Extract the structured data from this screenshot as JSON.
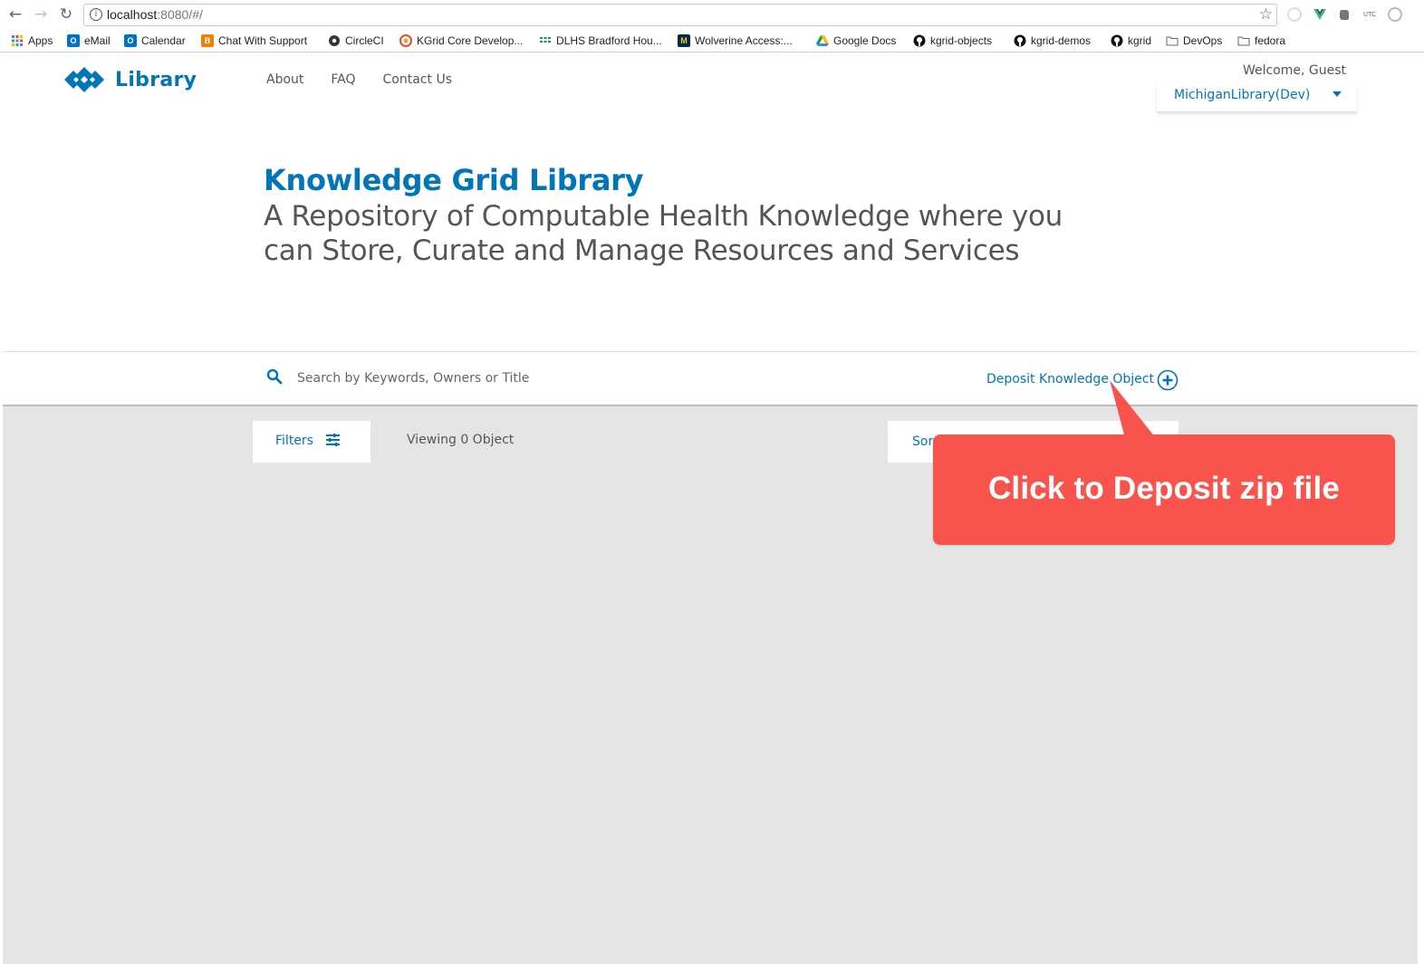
{
  "browser": {
    "url_host": "localhost",
    "url_rest": ":8080/#/",
    "bookmarks": [
      {
        "label": "Apps",
        "icon": "apps-grid-icon"
      },
      {
        "label": "eMail",
        "icon": "outlook-icon"
      },
      {
        "label": "Calendar",
        "icon": "outlook-calendar-icon"
      },
      {
        "label": "Chat With Support",
        "icon": "blogger-icon"
      },
      {
        "label": "CircleCI",
        "icon": "circleci-icon"
      },
      {
        "label": "KGrid Core Develop...",
        "icon": "kgrid-icon"
      },
      {
        "label": "DLHS Bradford Hou...",
        "icon": "sheets-grid-icon"
      },
      {
        "label": "Wolverine Access:...",
        "icon": "michigan-m-icon"
      },
      {
        "label": "Google Docs",
        "icon": "google-drive-icon"
      },
      {
        "label": "kgrid-objects",
        "icon": "github-icon"
      },
      {
        "label": "kgrid-demos",
        "icon": "github-icon"
      },
      {
        "label": "kgrid",
        "icon": "github-icon"
      },
      {
        "label": "DevOps",
        "icon": "folder-icon"
      },
      {
        "label": "fedora",
        "icon": "folder-icon"
      }
    ]
  },
  "header": {
    "logo_text": "Library",
    "nav": [
      "About",
      "FAQ",
      "Contact Us"
    ],
    "welcome": "Welcome, Guest",
    "library_selected": "MichiganLibrary(Dev)"
  },
  "hero": {
    "title": "Knowledge Grid Library",
    "subtitle": "A Repository of Computable Health Knowledge where you can Store, Curate and Manage Resources and Services"
  },
  "search": {
    "placeholder": "Search by Keywords, Owners or Title",
    "deposit_label": "Deposit Knowledge Object"
  },
  "toolbar": {
    "filters_label": "Filters",
    "viewing_text": "Viewing 0 Object",
    "sort_label_visible": "Sor"
  },
  "annotation": {
    "text": "Click to Deposit zip file"
  },
  "colors": {
    "brand": "#0075b8",
    "callout": "#f9534e",
    "content_bg": "#e5e5e5"
  }
}
